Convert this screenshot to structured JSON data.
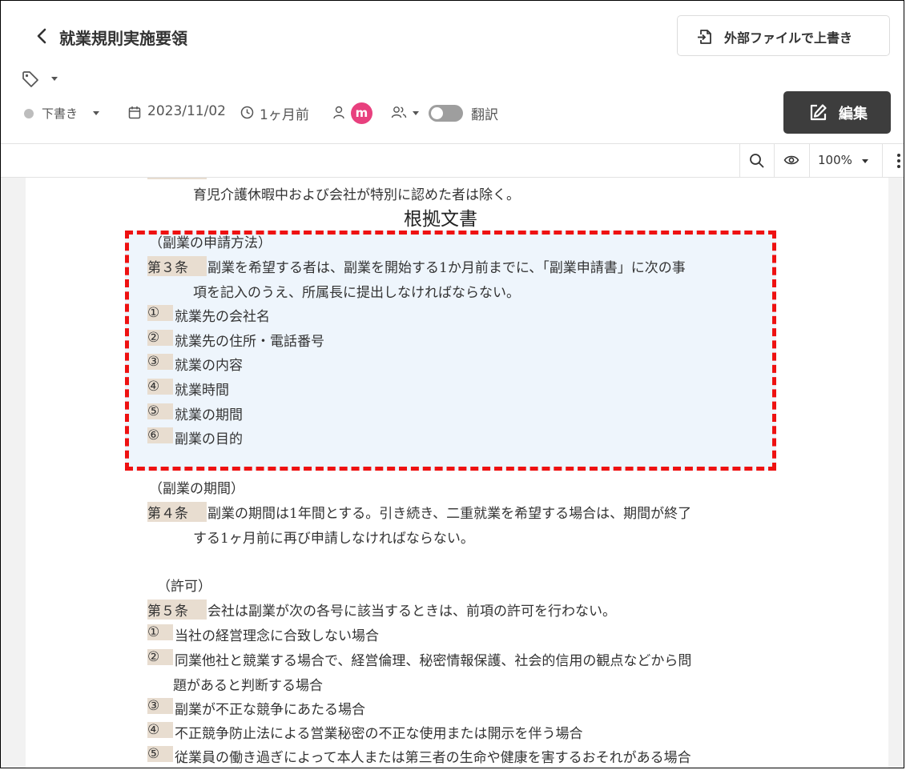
{
  "header": {
    "back_icon": "chevron-left-icon",
    "title": "就業規則実施要領",
    "overwrite_button": "外部ファイルで上書き",
    "edit_button": "編集"
  },
  "meta": {
    "status": "下書き",
    "status_color": "#bdbdbd",
    "date": "2023/11/02",
    "relative_time": "1ヶ月前",
    "avatar_initial": "m",
    "avatar_color": "#e8407e",
    "translate_label": "翻訳",
    "translate_on": false
  },
  "toolbar": {
    "zoom": "100%"
  },
  "annotation": {
    "label": "根拠文書",
    "border_color": "#ee1111"
  },
  "document": {
    "prev_line": "育児介護休暇中および会社が特別に認めた者は除く。",
    "art3": {
      "heading": "（副業の申請方法）",
      "num": "第３条",
      "text1": "副業を希望する者は、副業を開始する1か月前までに、「副業申請書」に次の事",
      "text2": "項を記入のうえ、所属長に提出しなければならない。",
      "items": [
        {
          "mark": "①",
          "text": "就業先の会社名"
        },
        {
          "mark": "②",
          "text": "就業先の住所・電話番号"
        },
        {
          "mark": "③",
          "text": "就業の内容"
        },
        {
          "mark": "④",
          "text": "就業時間"
        },
        {
          "mark": "⑤",
          "text": "就業の期間"
        },
        {
          "mark": "⑥",
          "text": "副業の目的"
        }
      ]
    },
    "art4": {
      "heading": "（副業の期間）",
      "num": "第４条",
      "text1": "副業の期間は1年間とする。引き続き、二重就業を希望する場合は、期間が終了",
      "text2": "する1ヶ月前に再び申請しなければならない。"
    },
    "art5": {
      "heading": "（許可）",
      "num": "第５条",
      "text1": "会社は副業が次の各号に該当するときは、前項の許可を行わない。",
      "items": [
        {
          "mark": "①",
          "text": "当社の経営理念に合致しない場合"
        },
        {
          "mark": "②",
          "text": "同業他社と競業する場合で、経営倫理、秘密情報保護、社会的信用の観点などから問"
        },
        {
          "mark": "",
          "text": "題があると判断する場合"
        },
        {
          "mark": "③",
          "text": "副業が不正な競争にあたる場合"
        },
        {
          "mark": "④",
          "text": "不正競争防止法による営業秘密の不正な使用または開示を伴う場合"
        },
        {
          "mark": "⑤",
          "text": "従業員の働き過ぎによって本人または第三者の生命や健康を害するおそれがある場合"
        }
      ]
    }
  }
}
